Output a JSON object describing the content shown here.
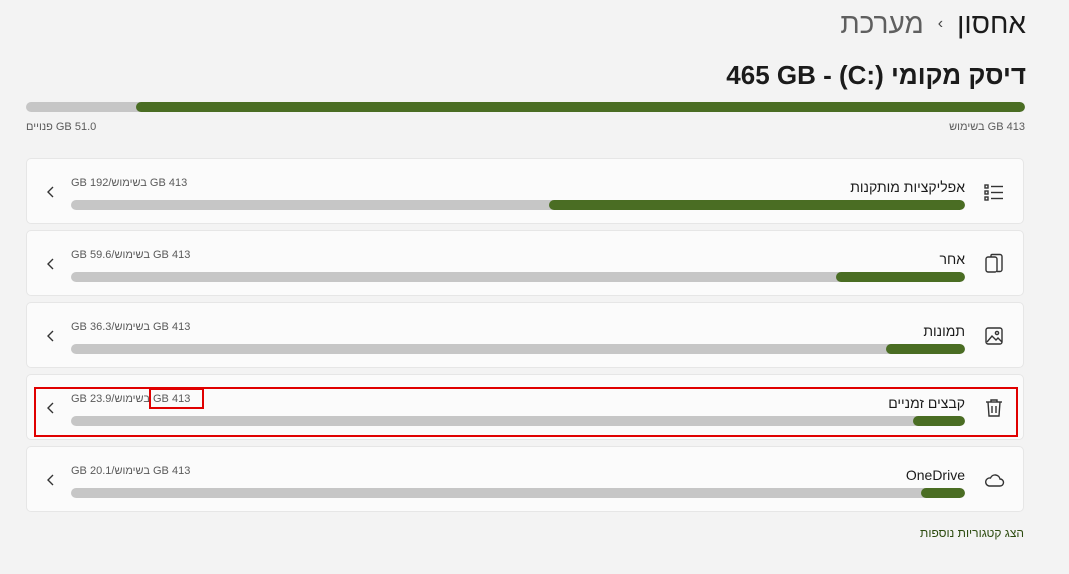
{
  "breadcrumb": {
    "parent": "מערכת",
    "separator": "›",
    "current": "אחסון"
  },
  "drive": {
    "title": "465 GB - (C:) דיסק מקומי",
    "used_label": "413 GB בשימוש",
    "free_label": "51.0 GB פנויים",
    "used_fraction": 0.89
  },
  "categories": [
    {
      "name": "אפליקציות מותקנות",
      "size": "192 GB",
      "total": "413 GB בשימוש",
      "fraction": 0.465,
      "icon": "apps-list-icon"
    },
    {
      "name": "אחר",
      "size": "59.6 GB",
      "total": "413 GB בשימוש",
      "fraction": 0.144,
      "icon": "other-files-icon"
    },
    {
      "name": "תמונות",
      "size": "36.3 GB",
      "total": "413 GB בשימוש",
      "fraction": 0.088,
      "icon": "pictures-icon"
    },
    {
      "name": "קבצים זמניים",
      "size": "23.9 GB",
      "total": "413 GB בשימוש",
      "fraction": 0.058,
      "icon": "trash-icon"
    },
    {
      "name": "OneDrive",
      "size": "20.1 GB",
      "total": "413 GB בשימוש",
      "fraction": 0.049,
      "icon": "cloud-icon"
    }
  ],
  "more_link": "הצג קטגוריות נוספות",
  "colors": {
    "accent": "#4a6d23",
    "track": "#c6c6c6",
    "highlight": "#e00000"
  }
}
